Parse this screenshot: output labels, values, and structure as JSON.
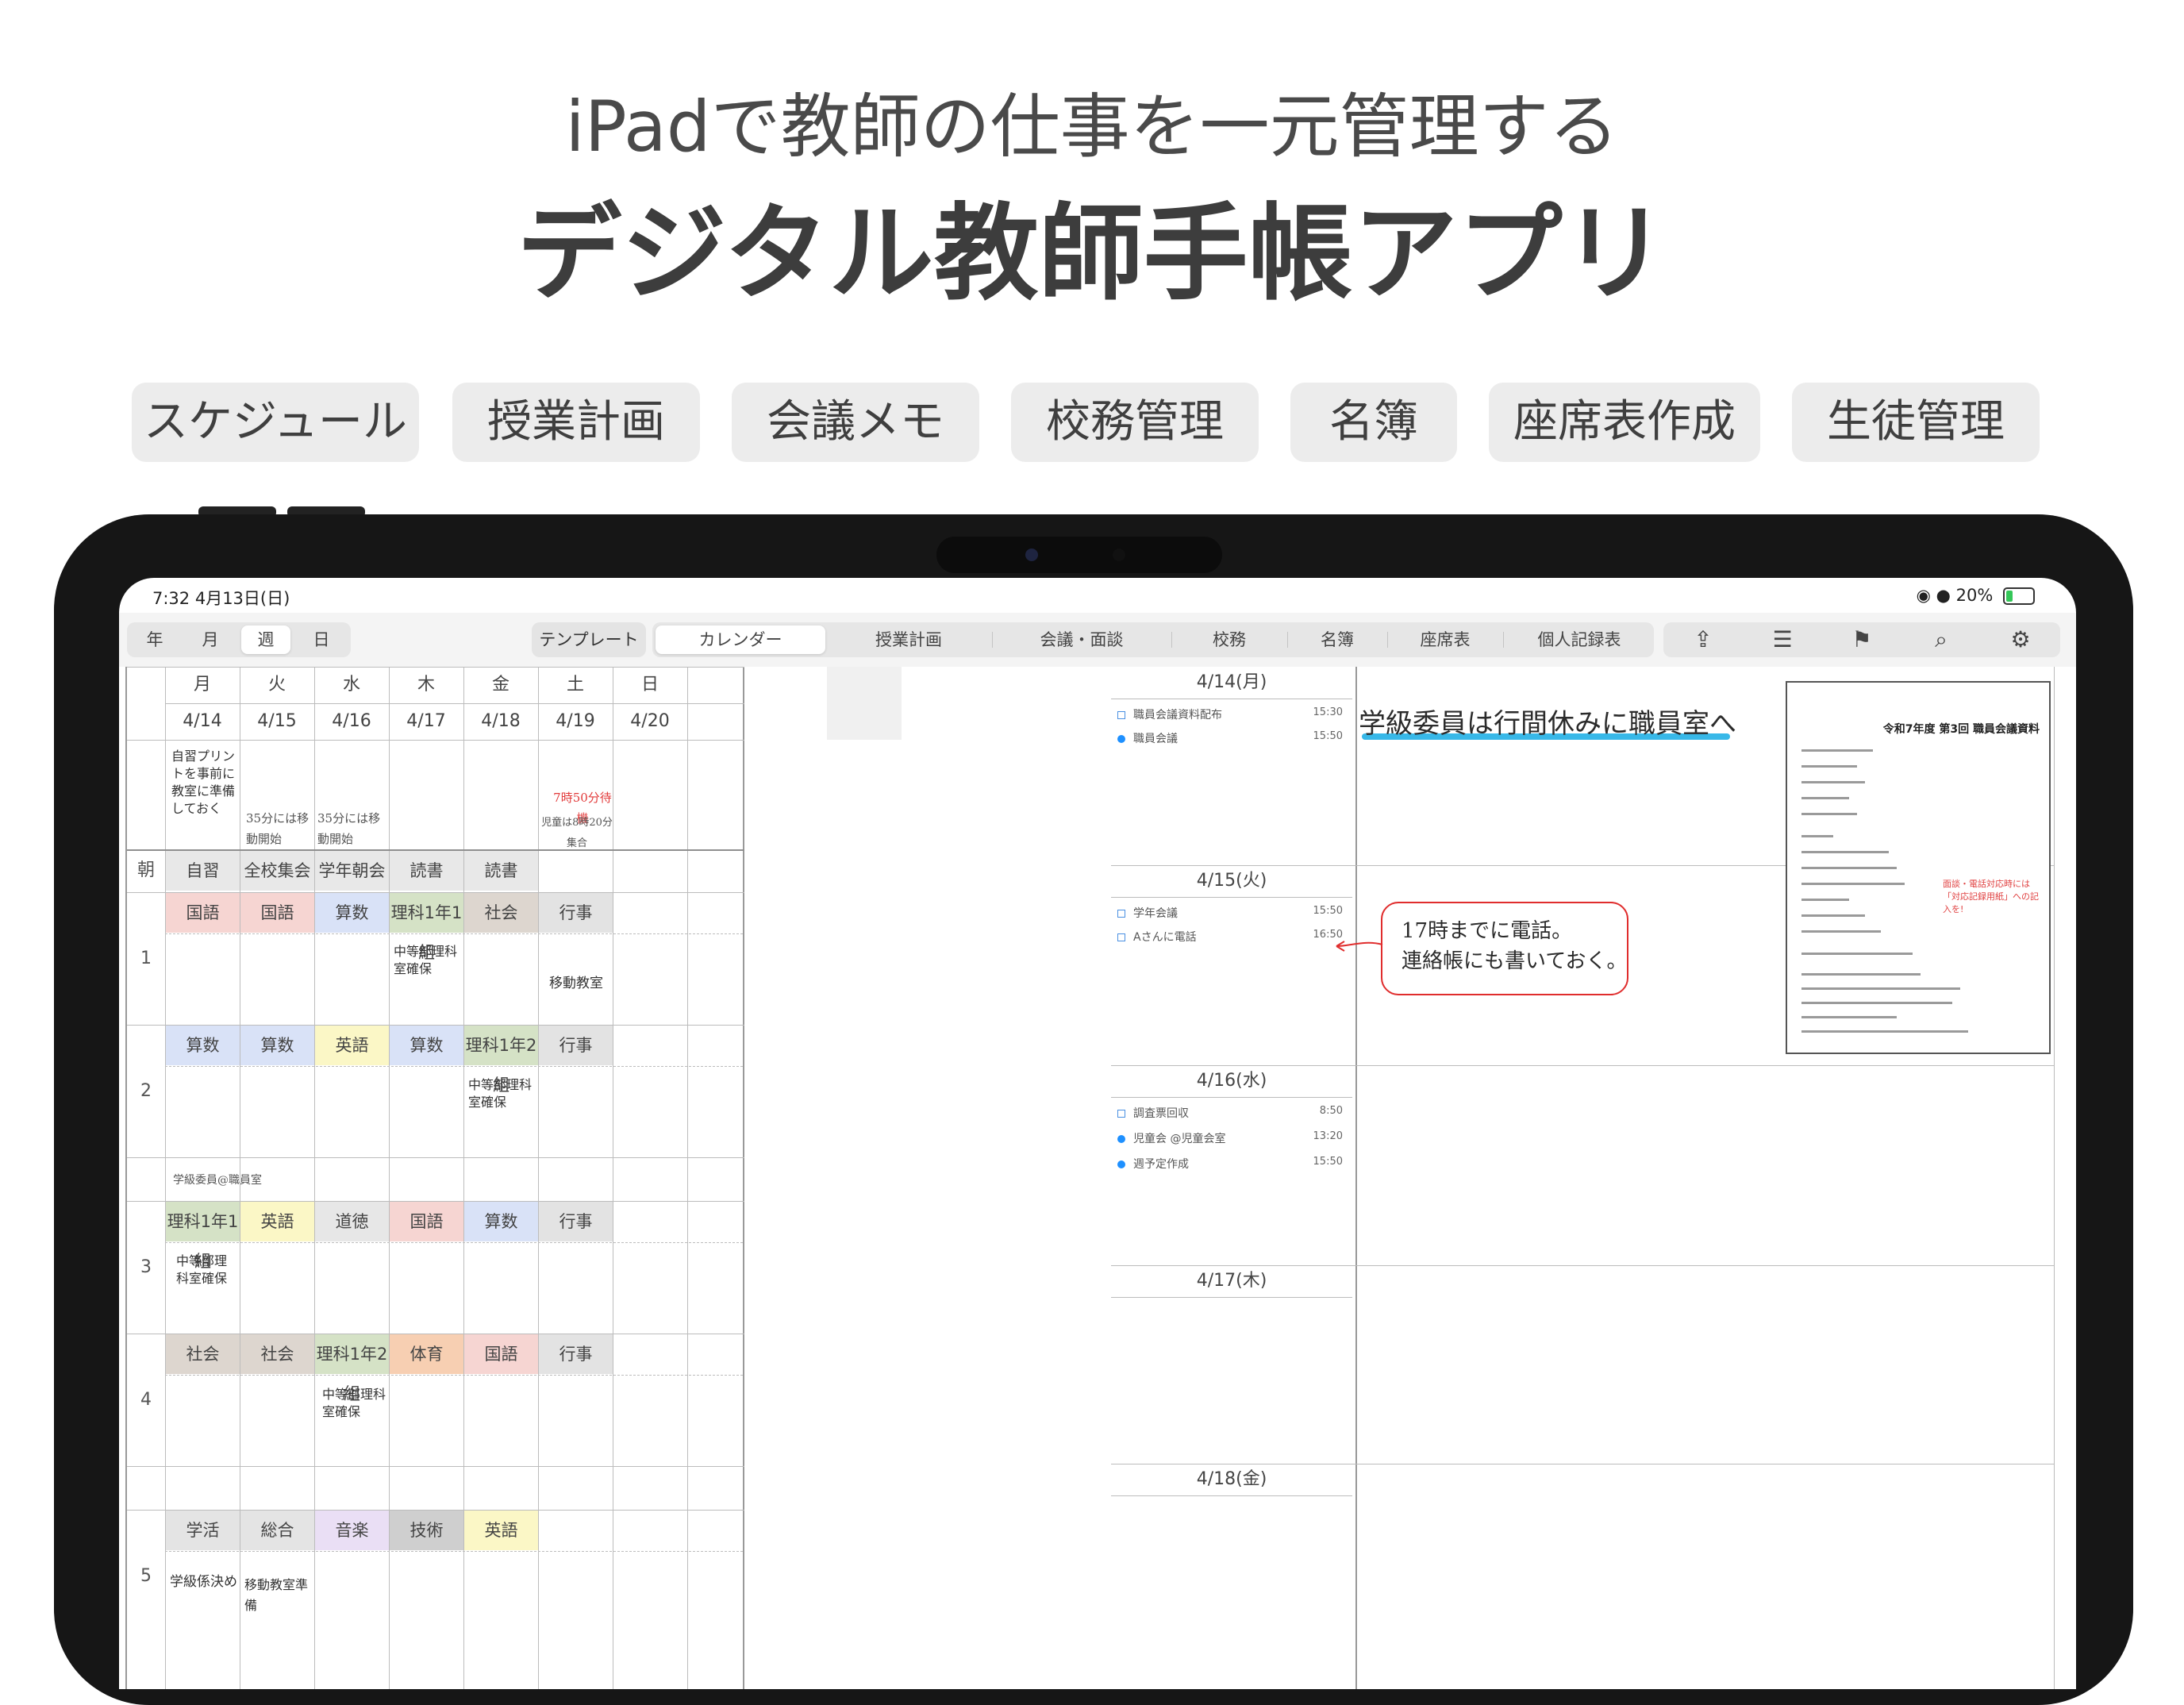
{
  "hero": {
    "subtitle": "iPadで教師の仕事を一元管理する",
    "title": "デジタル教師手帳アプリ"
  },
  "features": [
    "スケジュール",
    "授業計画",
    "会議メモ",
    "校務管理",
    "名簿",
    "座席表作成",
    "生徒管理"
  ],
  "status_bar": {
    "time_date": "7:32  4月13日(日)",
    "battery": "20%"
  },
  "toolbar": {
    "view_modes": [
      "年",
      "月",
      "週",
      "日"
    ],
    "active_view": "週",
    "template_label": "テンプレート",
    "tabs": [
      "カレンダー",
      "授業計画",
      "会議・面談",
      "校務",
      "名簿",
      "座席表",
      "個人記録表"
    ],
    "active_tab": "カレンダー",
    "icons": [
      "share-icon",
      "list-icon",
      "bookmark-icon",
      "search-icon",
      "settings-icon"
    ]
  },
  "week": {
    "days": [
      "月",
      "火",
      "水",
      "木",
      "金",
      "土",
      "日"
    ],
    "dates": [
      "4/14",
      "4/15",
      "4/16",
      "4/17",
      "4/18",
      "4/19",
      "4/20"
    ],
    "memos": {
      "mon": "自習プリントを事前に教室に準備しておく",
      "tue": "35分には移動開始",
      "wed": "35分には移動開始",
      "sat_1": "7時50分待機",
      "sat_2": "児童は8時20分集合"
    },
    "morning_label": "朝",
    "morning": [
      "自習",
      "全校集会",
      "学年朝会",
      "読書",
      "読書",
      "",
      ""
    ],
    "periods": [
      {
        "num": "1",
        "subjects": [
          "国語",
          "国語",
          "算数",
          "理科1年1組",
          "社会",
          "行事",
          ""
        ],
        "notes": {
          "thu": "中等部理科室確保",
          "sat": "移動教室"
        }
      },
      {
        "num": "2",
        "subjects": [
          "算数",
          "算数",
          "英語",
          "算数",
          "理科1年2組",
          "行事",
          ""
        ],
        "notes": {
          "fri": "中等部理科室確保"
        }
      },
      {
        "num": "3",
        "subjects": [
          "理科1年1組",
          "英語",
          "道徳",
          "国語",
          "算数",
          "行事",
          ""
        ],
        "notes": {
          "mon": "中等部理科室確保"
        },
        "pre_note": "学級委員@職員室"
      },
      {
        "num": "4",
        "subjects": [
          "社会",
          "社会",
          "理科1年2組",
          "体育",
          "国語",
          "行事",
          ""
        ],
        "notes": {
          "wed": "中等部理科室確保"
        }
      },
      {
        "num": "5",
        "subjects": [
          "学活",
          "総合",
          "音楽",
          "技術",
          "英語",
          "",
          ""
        ],
        "notes": {
          "mon": "学級係決め",
          "tue": "移動教室準備"
        }
      }
    ],
    "subject_colors": {
      "国語": "#f6d5d2",
      "算数": "#d9e2f7",
      "英語": "#fbf7c6",
      "理科1年1組": "#d5e2c6",
      "理科1年2組": "#d5e2c6",
      "社会": "#ddd6cf",
      "体育": "#f7cfb2",
      "道徳": "#e7e7e7",
      "学活": "#e4e4e4",
      "総合": "#e4e4e4",
      "音楽": "#eadff5",
      "技術": "#cfcfcf",
      "行事": "#e3e3e3",
      "自習": "#e8e8e8",
      "全校集会": "#e8e8e8",
      "学年朝会": "#e8e8e8",
      "読書": "#e8e8e8"
    }
  },
  "day_lists": [
    {
      "header": "4/14(月)",
      "events": [
        {
          "type": "box",
          "title": "職員会議資料配布",
          "time": "15:30"
        },
        {
          "type": "dot",
          "title": "職員会議",
          "time": "15:50"
        }
      ]
    },
    {
      "header": "4/15(火)",
      "events": [
        {
          "type": "box",
          "title": "学年会議",
          "time": "15:50"
        },
        {
          "type": "box",
          "title": "Aさんに電話",
          "time": "16:50"
        }
      ]
    },
    {
      "header": "4/16(水)",
      "events": [
        {
          "type": "box",
          "title": "調査票回収",
          "time": "8:50"
        },
        {
          "type": "dot",
          "title": "児童会 @児童会室",
          "time": "13:20"
        },
        {
          "type": "dot",
          "title": "週予定作成",
          "time": "15:50"
        }
      ]
    },
    {
      "header": "4/17(木)",
      "events": []
    },
    {
      "header": "4/18(金)",
      "events": []
    }
  ],
  "handwriting": {
    "note1": "学級委員は行間休みに職員室へ",
    "note2_line1": "17時までに電話。",
    "note2_line2": "連絡帳にも書いておく。"
  },
  "document": {
    "title": "令和7年度 第3回 職員会議資料",
    "annotation": "面談・電話対応時には「対応記録用紙」への記入を!"
  }
}
